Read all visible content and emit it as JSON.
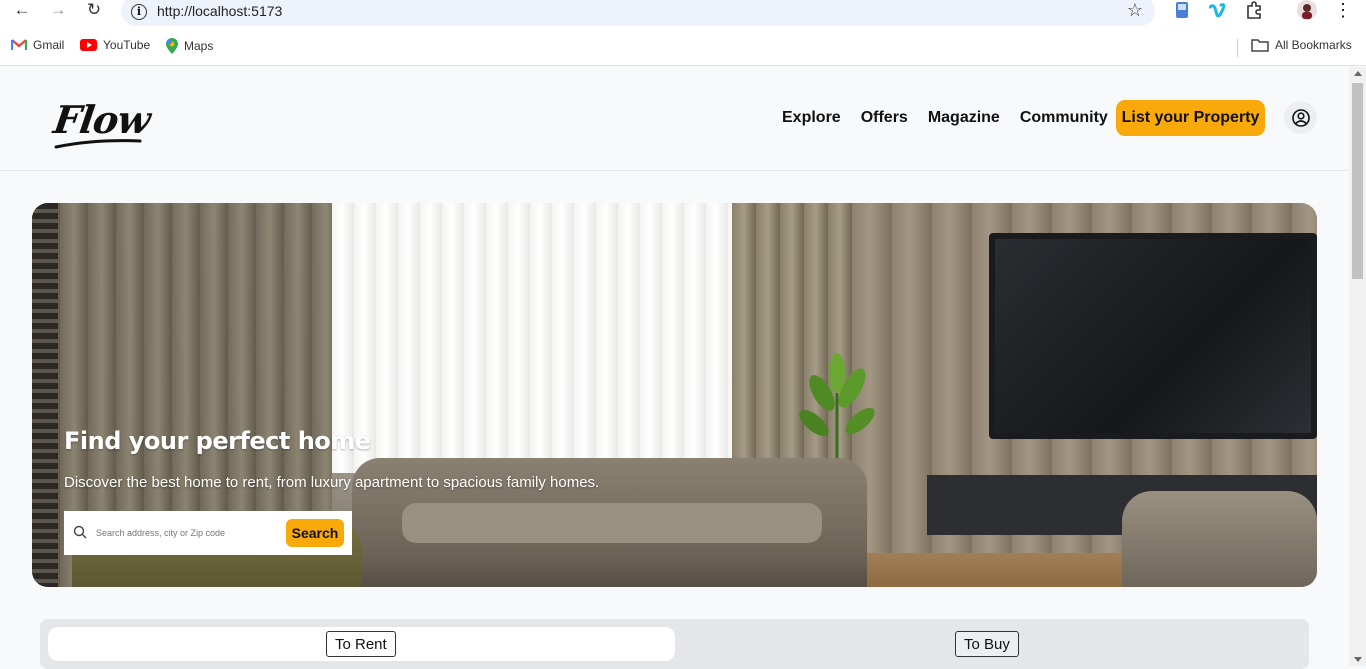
{
  "browser": {
    "url": "http://localhost:5173",
    "bookmarks": [
      {
        "label": "Gmail",
        "icon": "gmail-icon"
      },
      {
        "label": "YouTube",
        "icon": "youtube-icon"
      },
      {
        "label": "Maps",
        "icon": "maps-icon"
      }
    ],
    "all_bookmarks": "All Bookmarks"
  },
  "header": {
    "logo": "Flow",
    "nav": [
      "Explore",
      "Offers",
      "Magazine",
      "Community"
    ],
    "cta": "List your Property"
  },
  "hero": {
    "title": "Find your perfect home",
    "subtitle": "Discover the best home to rent, from luxury apartment to spacious family homes.",
    "search_placeholder": "Search address, city or Zip code",
    "search_button": "Search"
  },
  "tabs": {
    "rent": "To Rent",
    "buy": "To Buy",
    "active": "rent"
  },
  "colors": {
    "accent": "#f9a90a",
    "page_bg": "#f8f9fb"
  }
}
